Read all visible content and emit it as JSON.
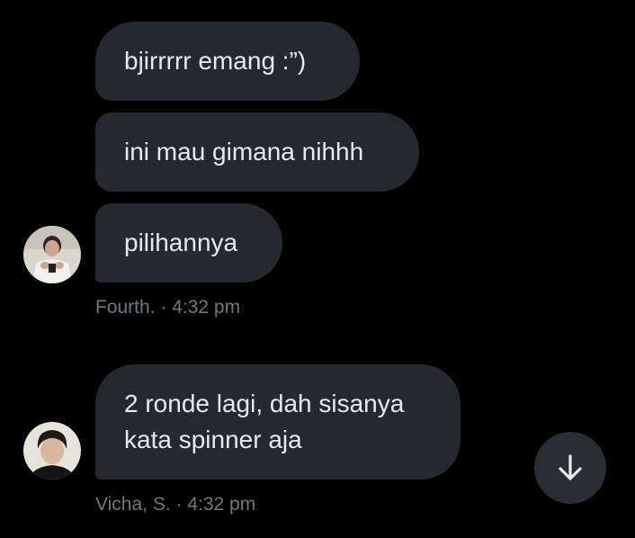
{
  "messages": [
    {
      "text": "bjirrrrr emang :”)"
    },
    {
      "text": "ini mau gimana nihhh"
    },
    {
      "text": "pilihannya"
    },
    {
      "lines": [
        "2 ronde lagi, dah sisanya",
        "kata spinner aja"
      ]
    }
  ],
  "meta": {
    "first": "Fourth. · 4:32 pm",
    "second": "Vicha, S. · 4:32 pm"
  },
  "icons": {
    "scroll_down": "arrow-down-icon"
  },
  "colors": {
    "background": "#000000",
    "bubble": "#25292f",
    "text": "#e7e9ea",
    "meta": "#71767b",
    "scroll_button": "#2a2e33"
  }
}
